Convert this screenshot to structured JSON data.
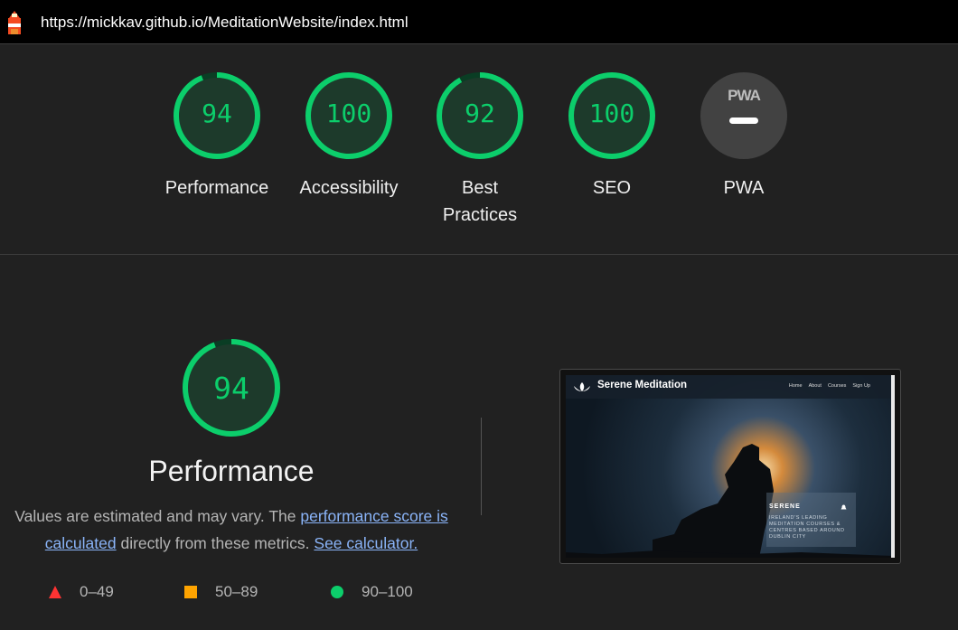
{
  "browser": {
    "url": "https://mickkav.github.io/MeditationWebsite/index.html"
  },
  "categories": [
    {
      "id": "performance",
      "score": "94",
      "score_value": 94,
      "label": "Performance"
    },
    {
      "id": "accessibility",
      "score": "100",
      "score_value": 100,
      "label": "Accessibility"
    },
    {
      "id": "best-practices",
      "score": "92",
      "score_value": 92,
      "label": "Best Practices"
    },
    {
      "id": "seo",
      "score": "100",
      "score_value": 100,
      "label": "SEO"
    },
    {
      "id": "pwa",
      "score": "",
      "label": "PWA",
      "badge": "PWA"
    }
  ],
  "performance_section": {
    "score": "94",
    "score_value": 94,
    "title": "Performance",
    "desc_prefix": "Values are estimated and may vary. The ",
    "link_score": "performance score is calculated",
    "desc_middle": " directly from these metrics. ",
    "link_calculator": "See calculator.",
    "legend": [
      {
        "range": "0–49",
        "icon": "triangle-icon",
        "color": "#ff3333"
      },
      {
        "range": "50–89",
        "icon": "square-icon",
        "color": "#ffa400"
      },
      {
        "range": "90–100",
        "icon": "circle-icon",
        "color": "#0cce6b"
      }
    ]
  },
  "screenshot": {
    "site_title": "Serene Meditation",
    "nav": [
      "Home",
      "About",
      "Courses",
      "Sign Up"
    ],
    "box_title": "SERENE",
    "box_text": "Ireland's leading meditation courses & centres based around Dublin City"
  },
  "colors": {
    "pass": "#0cce6b",
    "bg": "#212121",
    "link": "#8ab4f8"
  }
}
